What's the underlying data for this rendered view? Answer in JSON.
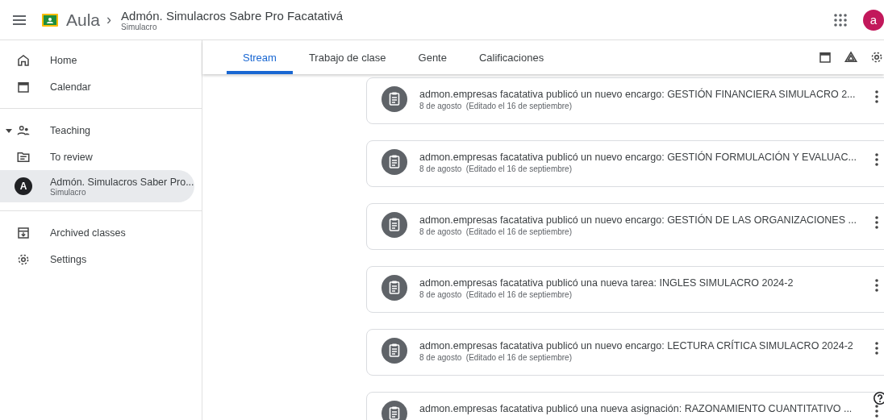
{
  "header": {
    "app_name": "Aula",
    "breadcrumb_sep": "›",
    "class_title": "Admón. Simulacros Sabre Pro Facatativá",
    "class_subtitle": "Simulacro",
    "avatar_letter": "a"
  },
  "sidebar": {
    "items": [
      {
        "kind": "link",
        "label": "Home",
        "selected": false
      },
      {
        "kind": "link",
        "label": "Calendar",
        "selected": false
      },
      {
        "kind": "divider"
      },
      {
        "kind": "section",
        "label": "Teaching",
        "expanded": true,
        "selected": false
      },
      {
        "kind": "link",
        "label": "To review",
        "selected": false
      },
      {
        "kind": "class",
        "letter": "A",
        "label": "Admón. Simulacros Saber Pro...",
        "sublabel": "Simulacro",
        "selected": true
      },
      {
        "kind": "divider"
      },
      {
        "kind": "link",
        "label": "Archived classes",
        "selected": false
      },
      {
        "kind": "link",
        "label": "Settings",
        "selected": false
      }
    ]
  },
  "tabs": [
    {
      "label": "Stream",
      "selected": true
    },
    {
      "label": "Trabajo de clase",
      "selected": false
    },
    {
      "label": "Gente",
      "selected": false
    },
    {
      "label": "Calificaciones",
      "selected": false
    }
  ],
  "posts": [
    {
      "title": "admon.empresas facatativa publicó un nuevo encargo: GESTIÓN FINANCIERA SIMULACRO 2...",
      "date": "8 de agosto",
      "edited": "(Editado el 16 de septiembre)"
    },
    {
      "title": "admon.empresas facatativa publicó un nuevo encargo: GESTIÓN FORMULACIÓN Y EVALUAC...",
      "date": "8 de agosto",
      "edited": "(Editado el 16 de septiembre)"
    },
    {
      "title": "admon.empresas facatativa publicó un nuevo encargo: GESTIÓN DE LAS ORGANIZACIONES ...",
      "date": "8 de agosto",
      "edited": "(Editado el 16 de septiembre)"
    },
    {
      "title": "admon.empresas facatativa publicó una nueva tarea: INGLES SIMULACRO 2024-2",
      "date": "8 de agosto",
      "edited": "(Editado el 16 de septiembre)"
    },
    {
      "title": "admon.empresas facatativa publicó un nuevo encargo: LECTURA CRÍTICA SIMULACRO 2024-2",
      "date": "8 de agosto",
      "edited": "(Editado el 16 de septiembre)"
    },
    {
      "title": "admon.empresas facatativa publicó una nueva asignación: RAZONAMIENTO CUANTITATIVO ..."
    }
  ]
}
